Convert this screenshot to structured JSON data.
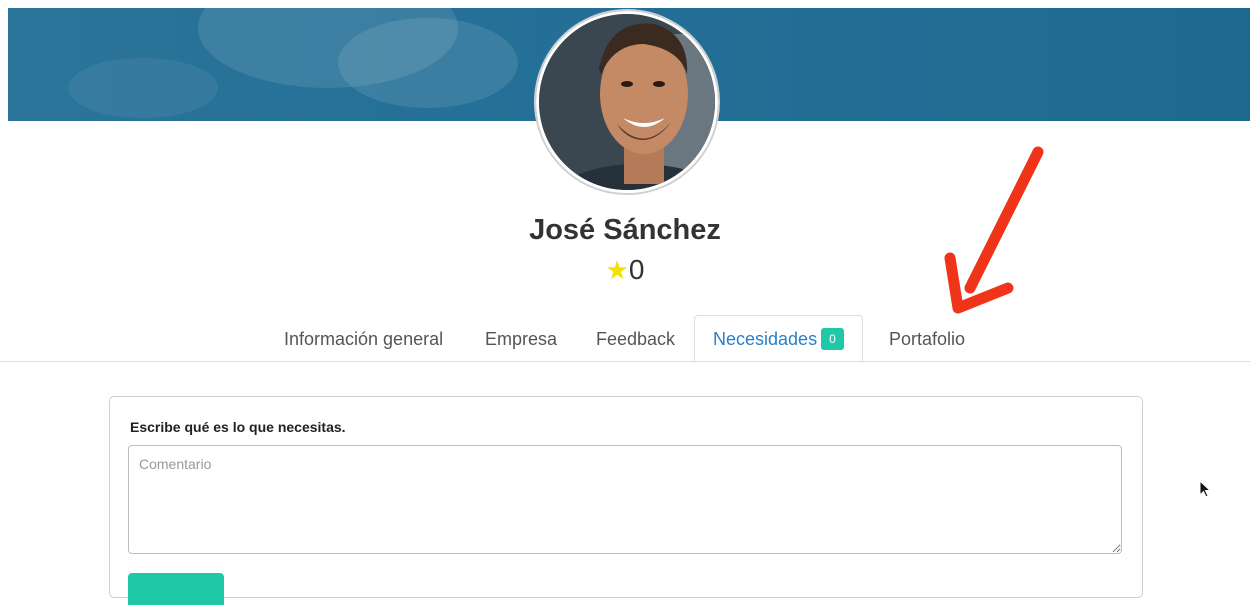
{
  "profile": {
    "name": "José Sánchez",
    "rating": "0"
  },
  "tabs": [
    {
      "label": "Información general"
    },
    {
      "label": "Empresa"
    },
    {
      "label": "Feedback"
    },
    {
      "label": "Necesidades",
      "badge": "0"
    },
    {
      "label": "Portafolio"
    }
  ],
  "needs_form": {
    "label": "Escribe qué es lo que necesitas.",
    "comment_placeholder": "Comentario",
    "comment_value": ""
  },
  "colors": {
    "cover": "#236f97",
    "accent": "#1fc9a8",
    "active_tab": "#2a7ec8",
    "star": "#f5e000",
    "annotation_arrow": "#f0341a"
  },
  "icons": [
    "star-icon",
    "annotation-arrow",
    "mouse-cursor"
  ]
}
